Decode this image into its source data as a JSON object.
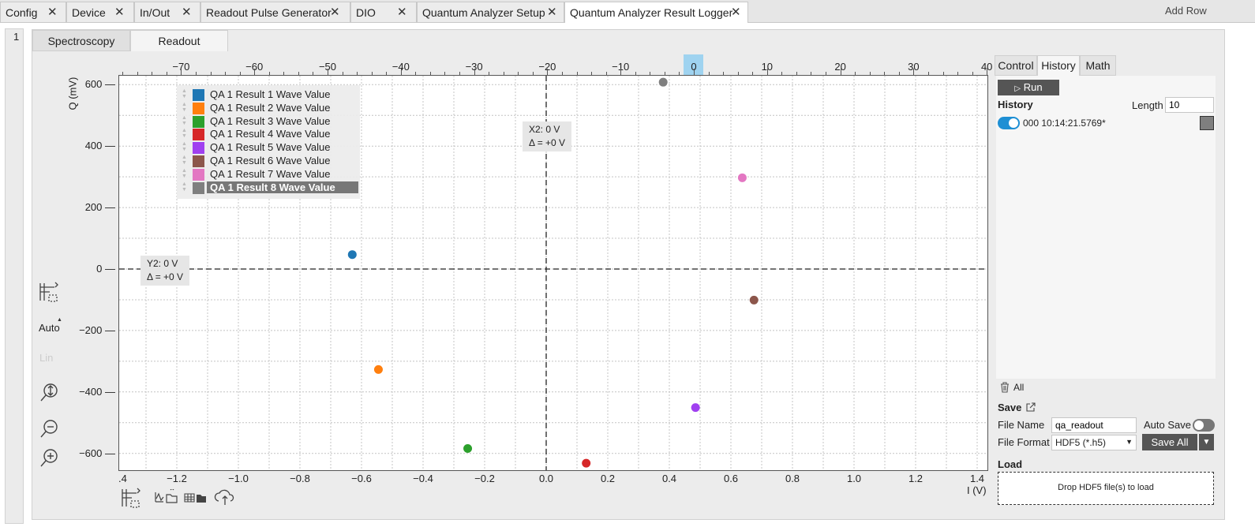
{
  "tabs": [
    {
      "label": "Config"
    },
    {
      "label": "Device"
    },
    {
      "label": "In/Out"
    },
    {
      "label": "Readout Pulse Generator"
    },
    {
      "label": "DIO"
    },
    {
      "label": "Quantum Analyzer Setup"
    },
    {
      "label": "Quantum Analyzer Result Logger"
    }
  ],
  "add_row": "Add Row",
  "row_number": "1",
  "subtabs": {
    "spectroscopy": "Spectroscopy",
    "readout": "Readout"
  },
  "plot": {
    "y_axis_label": "Q (mV)",
    "x_axis_label": "I (V)",
    "top_ticks": [
      "−70",
      "−60",
      "−50",
      "−40",
      "−30",
      "−20",
      "−10",
      "0",
      "10",
      "20",
      "30",
      "40"
    ],
    "bottom_ticks": [
      "−1.2",
      "−1.0",
      "−0.8",
      "−0.6",
      "−0.4",
      "−0.2",
      "0.0",
      "0.2",
      "0.4",
      "0.6",
      "0.8",
      "1.0",
      "1.2",
      "1.4"
    ],
    "bottom_edge_left": ".4",
    "left_ticks": [
      "600",
      "400",
      "200",
      "0",
      "−200",
      "−400",
      "−600"
    ],
    "cursor_x": {
      "value": "X2: 0 V",
      "delta": "Δ = +0 V"
    },
    "cursor_y": {
      "value": "Y2: 0 V",
      "delta": "Δ = +0 V"
    },
    "auto_label": "Auto",
    "lin_label": "Lin"
  },
  "chart_data": {
    "type": "scatter",
    "xlabel": "I (V)",
    "ylabel": "Q (mV)",
    "xlim": [
      -1.4,
      1.4
    ],
    "ylim": [
      -660,
      640
    ],
    "grid": true,
    "legend_position": "top-left",
    "series": [
      {
        "name": "QA 1 Result 1 Wave Value",
        "color": "#1f77b4",
        "x": -0.63,
        "y": 47
      },
      {
        "name": "QA 1 Result 2 Wave Value",
        "color": "#ff7f0e",
        "x": -0.545,
        "y": -327
      },
      {
        "name": "QA 1 Result 3 Wave Value",
        "color": "#2ca02c",
        "x": -0.255,
        "y": -584
      },
      {
        "name": "QA 1 Result 4 Wave Value",
        "color": "#d62728",
        "x": 0.13,
        "y": -632
      },
      {
        "name": "QA 1 Result 5 Wave Value",
        "color": "#a040f0",
        "x": 0.485,
        "y": -451
      },
      {
        "name": "QA 1 Result 6 Wave Value",
        "color": "#8c564b",
        "x": 0.675,
        "y": -101
      },
      {
        "name": "QA 1 Result 7 Wave Value",
        "color": "#e377c2",
        "x": 0.637,
        "y": 297
      },
      {
        "name": "QA 1 Result 8 Wave Value",
        "color": "#7f7f7f",
        "x": 0.38,
        "y": 608
      }
    ],
    "selected_series": "QA 1 Result 8 Wave Value"
  },
  "side": {
    "tabs": {
      "control": "Control",
      "history": "History",
      "math": "Math"
    },
    "run_label": "Run",
    "history_label": "History",
    "length_label": "Length",
    "length_value": "10",
    "history_entry": "000 10:14:21.5769*",
    "history_swatch_color": "#7f7f7f",
    "all_label": "All",
    "save_label": "Save",
    "file_name_label": "File Name",
    "file_name_value": "qa_readout",
    "auto_save_label": "Auto Save",
    "file_format_label": "File Format",
    "file_format_value": "HDF5 (*.h5)",
    "save_all_label": "Save All",
    "load_label": "Load",
    "drop_hint": "Drop HDF5 file(s) to load"
  }
}
